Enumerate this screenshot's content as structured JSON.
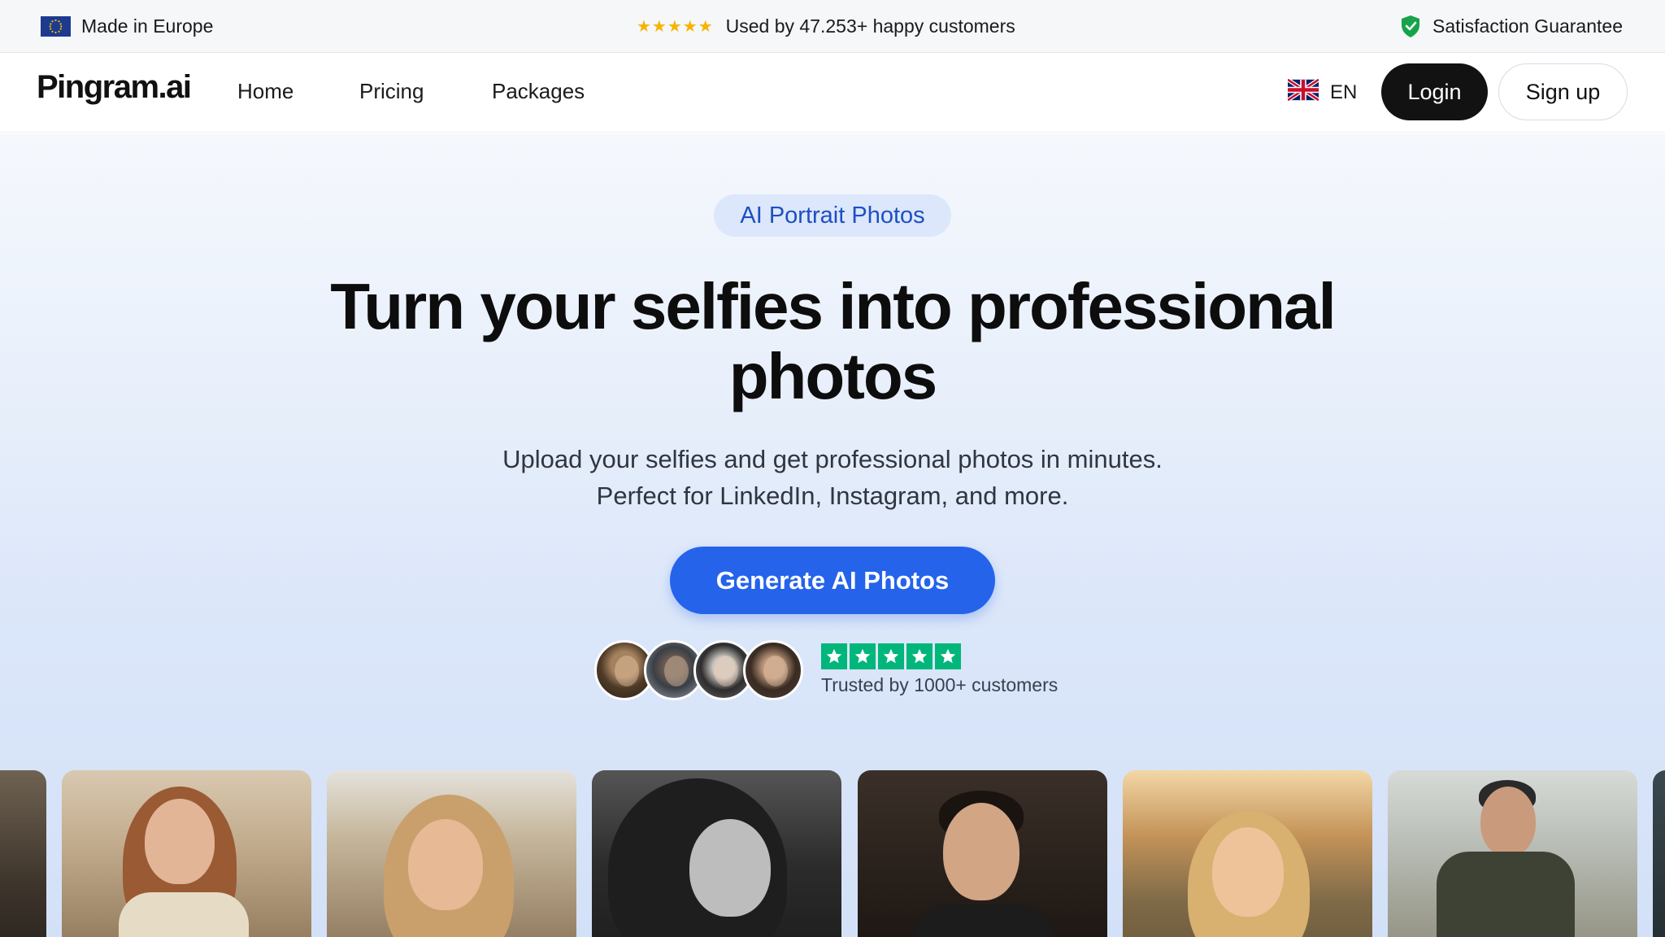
{
  "announcement": {
    "left_text": "Made in Europe",
    "center_text": "Used by 47.253+ happy customers",
    "center_stars": "★★★★★",
    "right_text": "Satisfaction Guarantee"
  },
  "nav": {
    "logo": "Pingram.ai",
    "links": [
      "Home",
      "Pricing",
      "Packages"
    ],
    "language": "EN",
    "login_label": "Login",
    "signup_label": "Sign up"
  },
  "hero": {
    "badge": "AI Portrait Photos",
    "headline_line1": "Turn your selfies into professional",
    "headline_line2": "photos",
    "subline_line1": "Upload your selfies and get professional photos in minutes.",
    "subline_line2": "Perfect for LinkedIn, Instagram, and more.",
    "cta_label": "Generate AI Photos",
    "rating_stars": 5,
    "trust_text": "Trusted by 1000+ customers"
  },
  "colors": {
    "accent": "#2563eb",
    "badge_text": "#1d4fc4",
    "trust_green": "#00b67a",
    "star_yellow": "#f5b400",
    "shield_green": "#16a34a",
    "login_bg": "#121212"
  },
  "icons": {
    "eu_flag": "eu-flag-icon",
    "stars": "star-icon",
    "shield": "shield-check-icon",
    "language_flag": "uk-flag-icon",
    "trust_star": "star-icon"
  }
}
